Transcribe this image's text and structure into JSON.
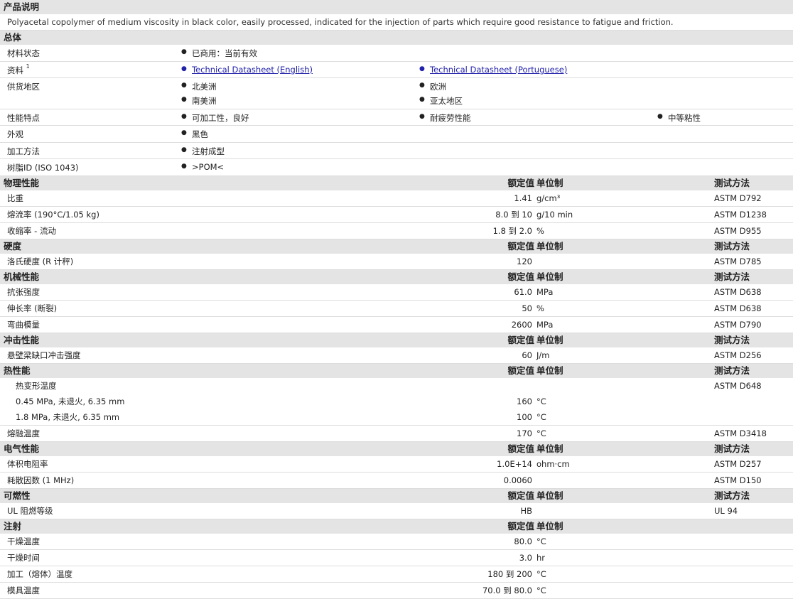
{
  "product_desc": {
    "title": "产品说明",
    "text": "Polyacetal copolymer of medium viscosity in black color, easily processed, indicated for the injection of parts which require good resistance to fatigue and friction."
  },
  "general": {
    "title": "总体",
    "rows": [
      {
        "label": "材料状态",
        "items": [
          "已商用：当前有效"
        ]
      },
      {
        "label": "资料",
        "sup": "1",
        "items": [
          "Technical Datasheet (English)",
          "Technical Datasheet (Portuguese)"
        ]
      },
      {
        "label": "供货地区",
        "items": [
          "北美洲",
          "欧洲",
          "南美洲",
          "亚太地区"
        ]
      },
      {
        "label": "性能特点",
        "items": [
          "可加工性，良好",
          "耐疲劳性能",
          "中等粘性"
        ]
      },
      {
        "label": "外观",
        "items": [
          "黑色"
        ]
      },
      {
        "label": "加工方法",
        "items": [
          "注射成型"
        ]
      },
      {
        "label": "树脂ID (ISO 1043)",
        "items": [
          ">POM<"
        ]
      }
    ]
  },
  "col_headers": {
    "value": "额定值",
    "unit": "单位制",
    "test": "测试方法"
  },
  "sections": [
    {
      "title": "物理性能",
      "show_test": true,
      "rows": [
        {
          "label": "比重",
          "value": "1.41",
          "unit": "g/cm³",
          "test": "ASTM D792"
        },
        {
          "label": "熔流率 (190°C/1.05 kg)",
          "value": "8.0 到  10",
          "unit": "g/10 min",
          "test": "ASTM D1238"
        },
        {
          "label": "收缩率 - 流动",
          "value": "1.8 到  2.0",
          "unit": "%",
          "test": "ASTM D955"
        }
      ]
    },
    {
      "title": "硬度",
      "show_test": true,
      "rows": [
        {
          "label": "洛氏硬度 (R 计秤)",
          "value": "120",
          "unit": "",
          "test": "ASTM D785"
        }
      ]
    },
    {
      "title": "机械性能",
      "show_test": true,
      "rows": [
        {
          "label": "抗张强度",
          "value": "61.0",
          "unit": "MPa",
          "test": "ASTM D638"
        },
        {
          "label": "伸长率 (断裂)",
          "value": "50",
          "unit": "%",
          "test": "ASTM D638"
        },
        {
          "label": "弯曲模量",
          "value": "2600",
          "unit": "MPa",
          "test": "ASTM D790"
        }
      ]
    },
    {
      "title": "冲击性能",
      "show_test": true,
      "rows": [
        {
          "label": "悬壁梁缺口冲击强度",
          "value": "60",
          "unit": "J/m",
          "test": "ASTM D256"
        }
      ]
    },
    {
      "title": "热性能",
      "show_test": true,
      "rows": [
        {
          "label": "热变形温度",
          "value": "",
          "unit": "",
          "test": "ASTM D648",
          "nob": true
        },
        {
          "label": "0.45 MPa, 未退火, 6.35 mm",
          "value": "160",
          "unit": "°C",
          "test": "",
          "sub": true
        },
        {
          "label": "1.8 MPa, 未退火, 6.35 mm",
          "value": "100",
          "unit": "°C",
          "test": "",
          "sub": true,
          "last": true
        },
        {
          "label": "熔融温度",
          "value": "170",
          "unit": "°C",
          "test": "ASTM D3418"
        }
      ]
    },
    {
      "title": "电气性能",
      "show_test": true,
      "rows": [
        {
          "label": "体积电阻率",
          "value": "1.0E+14",
          "unit": "ohm·cm",
          "test": "ASTM D257"
        },
        {
          "label": "耗散因数 (1 MHz)",
          "value": "0.0060",
          "unit": "",
          "test": "ASTM D150"
        }
      ]
    },
    {
      "title": "可燃性",
      "show_test": true,
      "rows": [
        {
          "label": "UL 阻燃等级",
          "value": "HB",
          "unit": "",
          "test": "UL 94"
        }
      ]
    },
    {
      "title": "注射",
      "show_test": false,
      "rows": [
        {
          "label": "干燥温度",
          "value": "80.0",
          "unit": "°C",
          "test": ""
        },
        {
          "label": "干燥时间",
          "value": "3.0",
          "unit": "hr",
          "test": ""
        },
        {
          "label": "加工（熔体）温度",
          "value": "180 到  200",
          "unit": "°C",
          "test": ""
        },
        {
          "label": "模具温度",
          "value": "70.0 到  80.0",
          "unit": "°C",
          "test": ""
        }
      ]
    }
  ]
}
